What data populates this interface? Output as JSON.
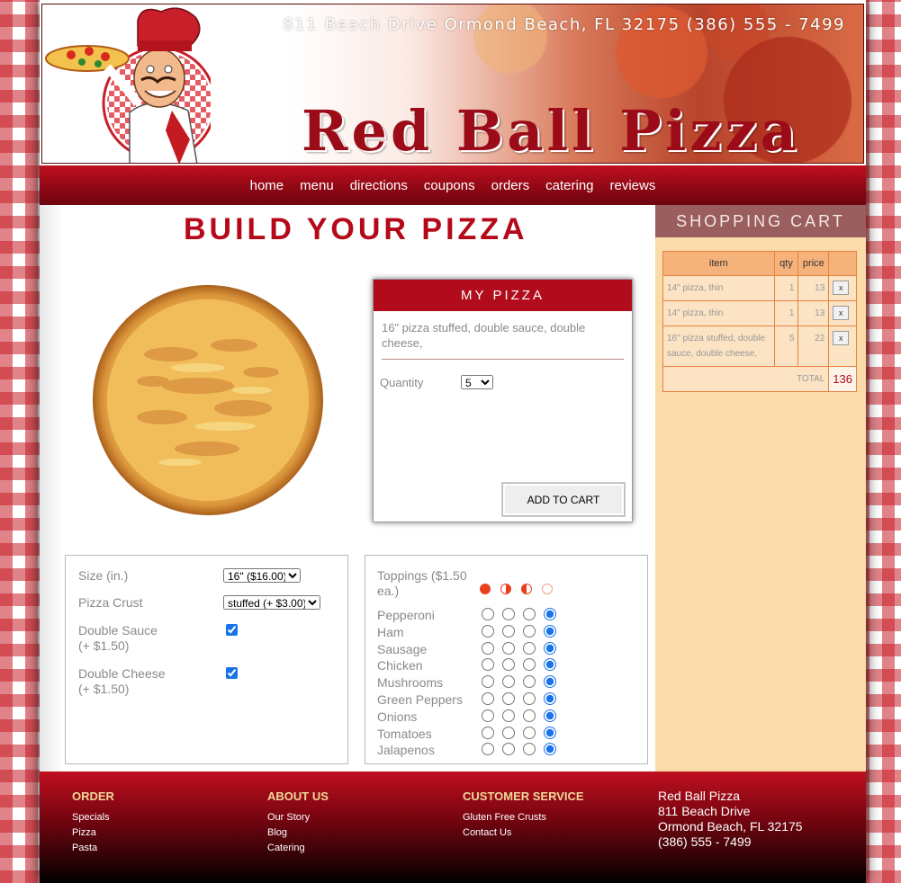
{
  "header": {
    "address": "811 Beach Drive  Ormond Beach, FL 32175   (386) 555 - 7499",
    "brand": "Red Ball Pizza"
  },
  "nav": {
    "items": [
      "home",
      "menu",
      "directions",
      "coupons",
      "orders",
      "catering",
      "reviews"
    ]
  },
  "main": {
    "title": "BUILD YOUR PIZZA",
    "my_pizza": {
      "heading": "MY PIZZA",
      "description": "16\" pizza stuffed, double sauce, double cheese,",
      "quantity_label": "Quantity",
      "quantity_value": "5",
      "add_button": "ADD TO CART"
    },
    "options": {
      "size_label": "Size (in.)",
      "size_value": "16\" ($16.00)",
      "crust_label": "Pizza Crust",
      "crust_value": "stuffed (+ $3.00)",
      "double_sauce_label": "Double Sauce",
      "double_sauce_price": "(+ $1.50)",
      "double_sauce_checked": true,
      "double_cheese_label": "Double Cheese",
      "double_cheese_price": "(+ $1.50)",
      "double_cheese_checked": true
    },
    "toppings": {
      "heading": "Toppings ($1.50 ea.)",
      "items": [
        {
          "name": "Pepperoni",
          "selected": 3
        },
        {
          "name": "Ham",
          "selected": 3
        },
        {
          "name": "Sausage",
          "selected": 3
        },
        {
          "name": "Chicken",
          "selected": 3
        },
        {
          "name": "Mushrooms",
          "selected": 3
        },
        {
          "name": "Green Peppers",
          "selected": 3
        },
        {
          "name": "Onions",
          "selected": 3
        },
        {
          "name": "Tomatoes",
          "selected": 3
        },
        {
          "name": "Jalapenos",
          "selected": 3
        }
      ]
    }
  },
  "cart": {
    "title": "SHOPPING CART",
    "columns": [
      "item",
      "qty",
      "price"
    ],
    "rows": [
      {
        "item": "14\" pizza, thin",
        "qty": "1",
        "price": "13",
        "remove": "x"
      },
      {
        "item": "14\" pizza, thin",
        "qty": "1",
        "price": "13",
        "remove": "x"
      },
      {
        "item": "16\" pizza stuffed, double sauce, double cheese,",
        "qty": "5",
        "price": "22",
        "remove": "x"
      }
    ],
    "total_label": "TOTAL",
    "total_value": "136"
  },
  "footer": {
    "order": {
      "heading": "ORDER",
      "links": [
        "Specials",
        "Pizza",
        "Pasta"
      ]
    },
    "about": {
      "heading": "ABOUT US",
      "links": [
        "Our Story",
        "Blog",
        "Catering"
      ]
    },
    "service": {
      "heading": "CUSTOMER SERVICE",
      "links": [
        "Gluten Free Crusts",
        "Contact Us"
      ]
    },
    "address": {
      "name": "Red Ball Pizza",
      "street": "811 Beach Drive",
      "city": "Ormond Beach, FL 32175",
      "phone": "(386) 555 - 7499"
    }
  },
  "colors": {
    "accent": "#b10b1c",
    "cart_bg": "#f9dcaa",
    "footer_heading": "#f0d89a"
  }
}
